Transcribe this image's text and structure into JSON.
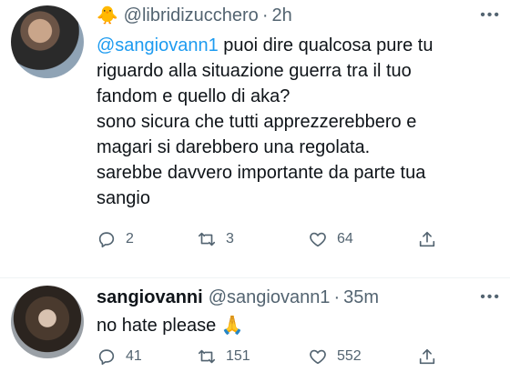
{
  "tweets": [
    {
      "emoji": "🐥",
      "display_name": "",
      "handle": "@libridizucchero",
      "separator": "·",
      "time": "2h",
      "mention": "@sangiovann1",
      "text_lines": [
        " puoi dire qualcosa pure tu",
        "riguardo alla situazione guerra tra il tuo",
        "fandom e quello di aka?",
        "sono sicura che tutti apprezzerebbero e",
        "magari si darebbero una regolata.",
        "sarebbe davvero importante da parte tua",
        "sangio"
      ],
      "more": "•••",
      "actions": {
        "replies": "2",
        "retweets": "3",
        "likes": "64"
      }
    },
    {
      "display_name": "sangiovanni",
      "handle": "@sangiovann1",
      "separator": "·",
      "time": "35m",
      "text": "no hate please",
      "emoji_in_text": "🙏",
      "more": "•••",
      "actions": {
        "replies": "41",
        "retweets": "151",
        "likes": "552"
      }
    }
  ],
  "icons": [
    "reply-icon",
    "retweet-icon",
    "like-icon",
    "share-icon"
  ],
  "colors": {
    "link": "#1d9bf0",
    "secondary": "#536471",
    "divider": "#eff3f4"
  }
}
